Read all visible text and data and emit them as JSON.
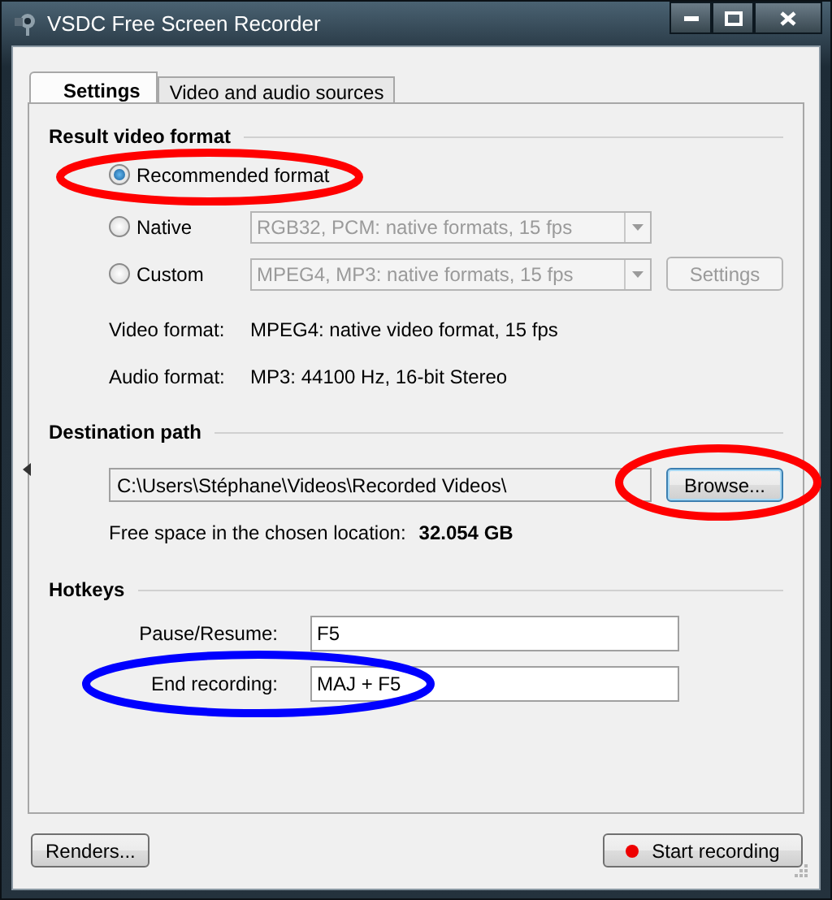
{
  "window": {
    "title": "VSDC Free Screen Recorder"
  },
  "tabs": [
    {
      "label": "Settings",
      "selected": true
    },
    {
      "label": "Video and audio sources",
      "selected": false
    }
  ],
  "result_video_format": {
    "heading": "Result video format",
    "options": [
      {
        "label": "Recommended format",
        "selected": true
      },
      {
        "label": "Native",
        "selected": false,
        "dropdown": {
          "value": "RGB32, PCM: native formats, 15 fps",
          "disabled": true
        }
      },
      {
        "label": "Custom",
        "selected": false,
        "dropdown": {
          "value": "MPEG4, MP3: native formats, 15 fps",
          "disabled": true
        },
        "button": {
          "label": "Settings",
          "disabled": true
        }
      }
    ],
    "info": [
      {
        "label": "Video format:",
        "value": "MPEG4: native video format, 15 fps"
      },
      {
        "label": "Audio format:",
        "value": "MP3: 44100 Hz, 16-bit Stereo"
      }
    ]
  },
  "destination": {
    "heading": "Destination path",
    "path": "C:\\Users\\Stéphane\\Videos\\Recorded Videos\\",
    "browse": {
      "label": "Browse...",
      "focused": true
    },
    "free_space_label": "Free space in the chosen location:",
    "free_space_value": "32.054 GB"
  },
  "hotkeys": {
    "heading": "Hotkeys",
    "items": [
      {
        "label": "Pause/Resume:",
        "value": "F5"
      },
      {
        "label": "End recording:",
        "value": "MAJ + F5"
      }
    ]
  },
  "footer": {
    "renders": "Renders...",
    "start": "Start recording"
  },
  "annotations": [
    {
      "color": "#ff0000"
    },
    {
      "color": "#ff0000"
    },
    {
      "color": "#0000ff"
    }
  ]
}
